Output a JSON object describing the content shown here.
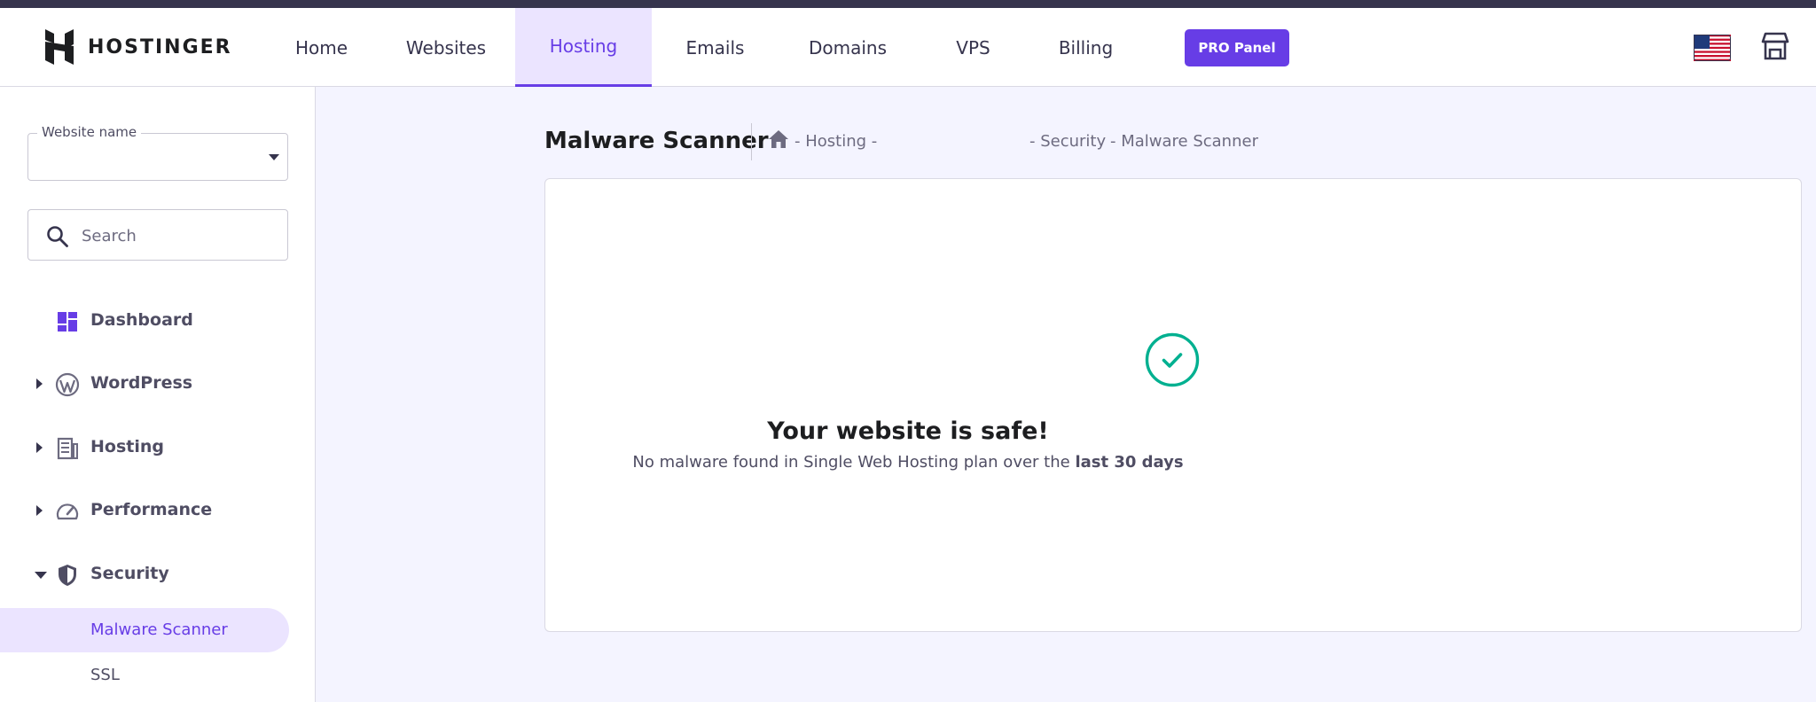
{
  "header": {
    "logo_text": "HOSTINGER",
    "nav": [
      {
        "label": "Home"
      },
      {
        "label": "Websites"
      },
      {
        "label": "Hosting",
        "active": true
      },
      {
        "label": "Emails"
      },
      {
        "label": "Domains"
      },
      {
        "label": "VPS"
      },
      {
        "label": "Billing"
      }
    ],
    "pro_panel_label": "PRO Panel",
    "language_icon": "us-flag-icon",
    "store_icon": "store-icon"
  },
  "sidebar": {
    "website_select_label": "Website name",
    "website_select_value": "",
    "search_placeholder": "Search",
    "menu": [
      {
        "label": "Dashboard",
        "icon": "dashboard-icon",
        "expandable": false
      },
      {
        "label": "WordPress",
        "icon": "wordpress-icon",
        "expandable": true,
        "expanded": false
      },
      {
        "label": "Hosting",
        "icon": "hosting-icon",
        "expandable": true,
        "expanded": false
      },
      {
        "label": "Performance",
        "icon": "performance-icon",
        "expandable": true,
        "expanded": false
      },
      {
        "label": "Security",
        "icon": "security-shield-icon",
        "expandable": true,
        "expanded": true
      }
    ],
    "security_subitems": [
      {
        "label": "Malware Scanner",
        "active": true
      },
      {
        "label": "SSL",
        "active": false
      }
    ]
  },
  "main": {
    "page_title": "Malware Scanner",
    "breadcrumb": {
      "hosting": "- Hosting -",
      "security": "- Security",
      "current": "- Malware Scanner"
    },
    "status": {
      "title": "Your website is safe!",
      "description": "No malware found in Single Web Hosting plan over the ",
      "description_bold": "last 30 days"
    }
  },
  "colors": {
    "accent": "#673de6",
    "accent_light": "#ebe4ff",
    "success": "#00b090",
    "page_bg": "#f4f4ff"
  }
}
